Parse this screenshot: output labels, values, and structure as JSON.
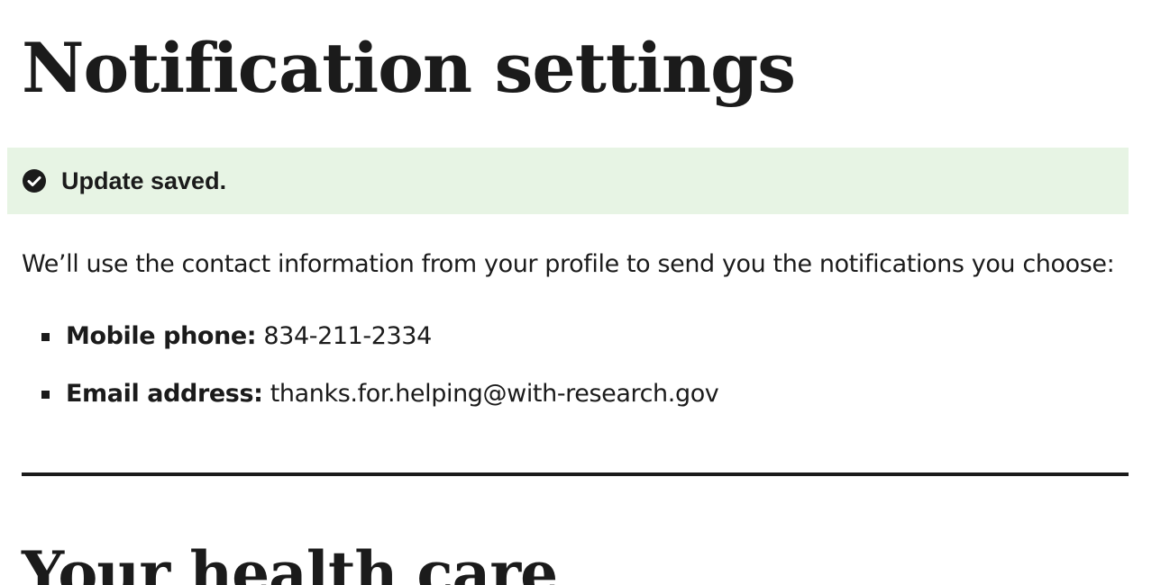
{
  "page": {
    "title": "Notification settings"
  },
  "alert": {
    "icon": "check-circle-icon",
    "message": "Update saved.",
    "background_color": "#e7f4e4",
    "status": "success"
  },
  "intro": {
    "text": "We’ll use the contact information from your profile to send you the notifications you choose:"
  },
  "contacts": [
    {
      "label": "Mobile phone:",
      "value": "834-211-2334"
    },
    {
      "label": "Email address:",
      "value": "thanks.for.helping@with-research.gov"
    }
  ],
  "sections": [
    {
      "heading": "Your health care"
    }
  ]
}
